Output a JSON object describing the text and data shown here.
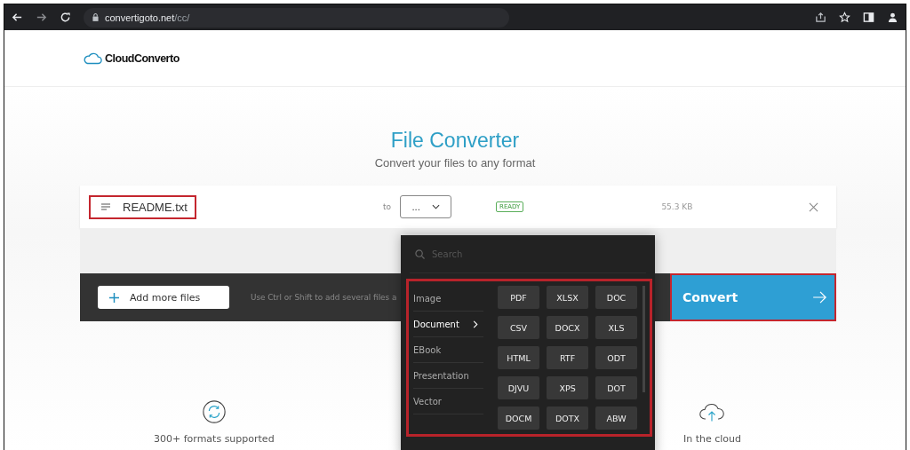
{
  "browser": {
    "url_host": "convertigoto.net",
    "url_path": "/cc/"
  },
  "logo": "CloudConverto",
  "title": "File Converter",
  "subtitle": "Convert your files to any format",
  "file": {
    "name": "README.txt",
    "to_label": "to",
    "format": "...",
    "status": "READY",
    "size": "55.3 KB",
    "highlighted": true
  },
  "toolbar": {
    "add_button": "Add more files",
    "hint": "Use Ctrl or Shift to add several files a"
  },
  "convert_button": {
    "label": "Convert",
    "highlighted": true
  },
  "format_menu": {
    "search_placeholder": "Search",
    "highlighted": true,
    "categories": [
      {
        "label": "Image",
        "selected": false
      },
      {
        "label": "Document",
        "selected": true
      },
      {
        "label": "EBook",
        "selected": false
      },
      {
        "label": "Presentation",
        "selected": false
      },
      {
        "label": "Vector",
        "selected": false
      }
    ],
    "formats": [
      "PDF",
      "XLSX",
      "DOC",
      "CSV",
      "DOCX",
      "XLS",
      "HTML",
      "RTF",
      "ODT",
      "DJVU",
      "XPS",
      "DOT",
      "DOCM",
      "DOTX",
      "ABW"
    ]
  },
  "features": [
    {
      "kind": "formats",
      "label": "300+ formats supported"
    },
    {
      "kind": "cloud",
      "label": "In the cloud"
    }
  ]
}
